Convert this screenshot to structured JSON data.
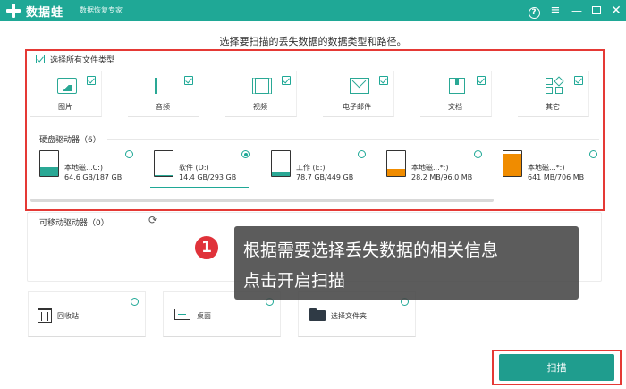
{
  "titlebar": {
    "app_name": "数据蛙",
    "subtitle": "数据恢复专家",
    "help": "?",
    "menu": "≡",
    "minimize": "—",
    "close": "✕"
  },
  "headline": "选择要扫描的丢失数据的数据类型和路径。",
  "select_all_label": "选择所有文件类型",
  "file_types": [
    {
      "label": "图片",
      "icon": "image-icon",
      "checked": true
    },
    {
      "label": "音频",
      "icon": "music-icon",
      "checked": true
    },
    {
      "label": "视频",
      "icon": "video-icon",
      "checked": true
    },
    {
      "label": "电子邮件",
      "icon": "mail-icon",
      "checked": true
    },
    {
      "label": "文档",
      "icon": "document-icon",
      "checked": true
    },
    {
      "label": "其它",
      "icon": "other-icon",
      "checked": true
    }
  ],
  "hard_drives": {
    "title": "硬盘驱动器（6）",
    "items": [
      {
        "name": "本地磁...C:)",
        "size": "64.6 GB/187 GB",
        "fill_fraction": 0.35,
        "fill_color": "#2aa895",
        "selected": false
      },
      {
        "name": "软件 (D:)",
        "size": "14.4 GB/293 GB",
        "fill_fraction": 0.05,
        "fill_color": "#2aa895",
        "selected": true
      },
      {
        "name": "工作 (E:)",
        "size": "78.7 GB/449 GB",
        "fill_fraction": 0.18,
        "fill_color": "#2aa895",
        "selected": false
      },
      {
        "name": "本地磁...*:)",
        "size": "28.2 MB/96.0 MB",
        "fill_fraction": 0.29,
        "fill_color": "#f08c00",
        "selected": false
      },
      {
        "name": "本地磁...*:)",
        "size": "641 MB/706 MB",
        "fill_fraction": 0.91,
        "fill_color": "#f08c00",
        "selected": false
      }
    ]
  },
  "removable": {
    "title": "可移动驱动器（0）",
    "refresh": "⟳"
  },
  "quick_locations": [
    {
      "label": "回收站",
      "icon": "trash-icon"
    },
    {
      "label": "桌面",
      "icon": "desktop-icon"
    },
    {
      "label": "选择文件夹",
      "icon": "folder-icon"
    }
  ],
  "tooltip": {
    "step": "1",
    "line1": "根据需要选择丢失数据的相关信息",
    "line2": "点击开启扫描"
  },
  "scan_button": "扫描",
  "colors": {
    "accent": "#1fa896",
    "highlight": "#e53935",
    "warning_fill": "#f08c00"
  }
}
